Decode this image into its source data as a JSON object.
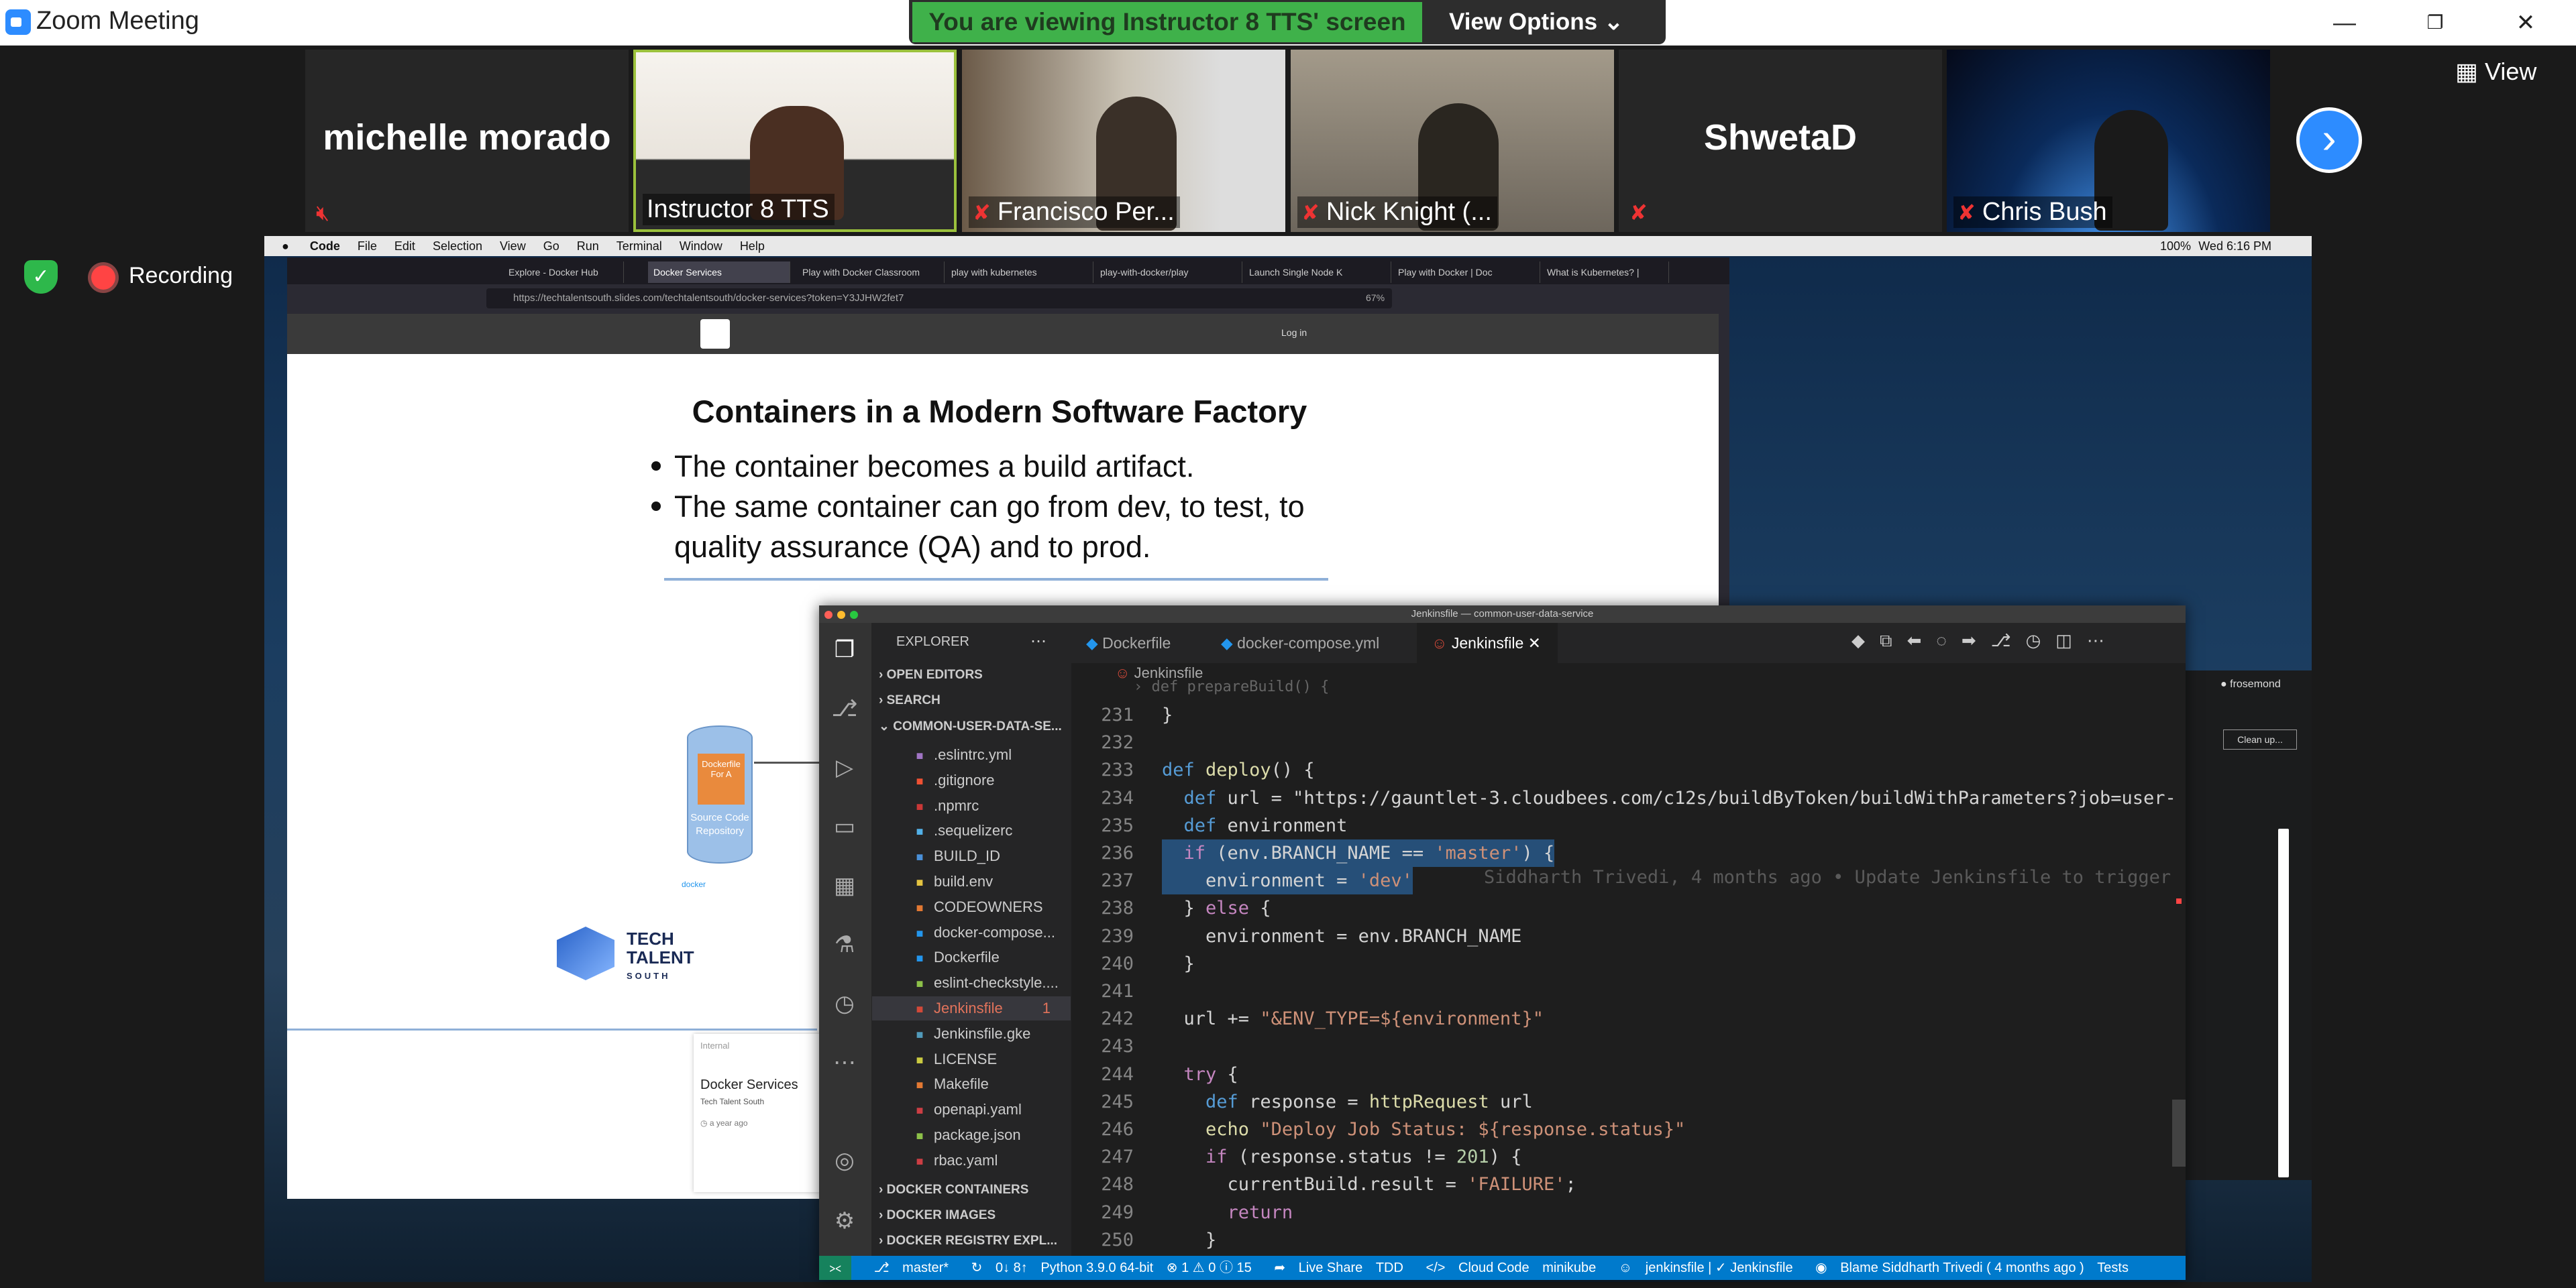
{
  "zoom": {
    "window_title": "Zoom Meeting",
    "viewing_banner": "You are viewing Instructor 8 TTS' screen",
    "view_options": "View Options",
    "view_label": "View",
    "recording": "Recording",
    "participants": [
      {
        "name": "michelle morado",
        "muted": true,
        "video": false
      },
      {
        "name": "Instructor 8 TTS",
        "muted": false,
        "video": true,
        "active": true
      },
      {
        "name": "Francisco Per...",
        "muted": true,
        "video": true
      },
      {
        "name": "Nick Knight (...",
        "muted": true,
        "video": true
      },
      {
        "name": "ShwetaD",
        "muted": true,
        "video": false
      },
      {
        "name": "Chris Bush",
        "muted": true,
        "video": true
      }
    ],
    "colors": {
      "accent": "#2d8cff",
      "banner_green": "#3fb14a",
      "active_border": "#9bc13c"
    }
  },
  "mac": {
    "menu": [
      "Code",
      "File",
      "Edit",
      "Selection",
      "View",
      "Go",
      "Run",
      "Terminal",
      "Window",
      "Help"
    ],
    "battery": "100%",
    "clock": "Wed 6:16 PM"
  },
  "browser": {
    "tabs": [
      "Explore - Docker Hub",
      "Docker Services",
      "Play with Docker Classroom",
      "play with kubernetes",
      "play-with-docker/play",
      "Launch Single Node K",
      "Play with Docker | Doc",
      "What is Kubernetes? |"
    ],
    "url": "https://techtalentsouth.slides.com/techtalentsouth/docker-services?token=Y3JJHW2fet7",
    "zoom": "67%",
    "login": "Log in"
  },
  "slide": {
    "title": "Containers in a Modern Software Factory",
    "bullets": [
      "The container becomes a build artifact.",
      "The same container can go from dev, to test, to",
      "quality assurance (QA) and to prod."
    ],
    "db_label_top": "Dockerfile For A",
    "db_label": "Source Code Repository",
    "docker_small": "docker",
    "logo_line1": "TECH",
    "logo_line2": "TALENT",
    "logo_line3": "SOUTH",
    "card_tag": "Internal",
    "card_title": "Docker Services",
    "card_sub": "Tech Talent South",
    "card_time": "a year ago",
    "user": "frosemond",
    "cleanup": "Clean up..."
  },
  "vscode": {
    "window_title": "Jenkinsfile — common-user-data-service",
    "explorer": "EXPLORER",
    "sections": {
      "open_editors": "OPEN EDITORS",
      "search": "SEARCH",
      "project": "COMMON-USER-DATA-SE...",
      "docker_containers": "DOCKER CONTAINERS",
      "docker_images": "DOCKER IMAGES",
      "docker_registry": "DOCKER REGISTRY EXPL..."
    },
    "files": [
      {
        "name": ".eslintrc.yml",
        "icon": "circle-icon",
        "color": "#a074c4"
      },
      {
        "name": ".gitignore",
        "icon": "git-icon",
        "color": "#f05133"
      },
      {
        "name": ".npmrc",
        "icon": "npm-icon",
        "color": "#cb3837"
      },
      {
        "name": ".sequelizerc",
        "icon": "sequelize-icon",
        "color": "#52b0e7"
      },
      {
        "name": "BUILD_ID",
        "icon": "text-icon",
        "color": "#4a90d9"
      },
      {
        "name": "build.env",
        "icon": "env-icon",
        "color": "#e4c441"
      },
      {
        "name": "CODEOWNERS",
        "icon": "owners-icon",
        "color": "#e37933"
      },
      {
        "name": "docker-compose...",
        "icon": "docker-icon",
        "color": "#2396ed"
      },
      {
        "name": "Dockerfile",
        "icon": "docker-icon",
        "color": "#2396ed"
      },
      {
        "name": "eslint-checkstyle....",
        "icon": "file-icon",
        "color": "#8dc149"
      },
      {
        "name": "Jenkinsfile",
        "icon": "jenkins-icon",
        "color": "#d24939",
        "badge": "1",
        "selected": true
      },
      {
        "name": "Jenkinsfile.gke",
        "icon": "gke-icon",
        "color": "#519aba"
      },
      {
        "name": "LICENSE",
        "icon": "license-icon",
        "color": "#cbcb41"
      },
      {
        "name": "Makefile",
        "icon": "make-icon",
        "color": "#e37933"
      },
      {
        "name": "openapi.yaml",
        "icon": "braces-icon",
        "color": "#cc3e44"
      },
      {
        "name": "package.json",
        "icon": "package-icon",
        "color": "#8dc149"
      },
      {
        "name": "rbac.yaml",
        "icon": "braces-icon",
        "color": "#cc3e44"
      }
    ],
    "tabs": [
      "Dockerfile",
      "docker-compose.yml",
      "Jenkinsfile"
    ],
    "breadcrumb": "Jenkinsfile",
    "code": [
      {
        "n": "231",
        "t": "}"
      },
      {
        "n": "232",
        "t": ""
      },
      {
        "n": "233",
        "t": "def deploy() {"
      },
      {
        "n": "234",
        "t": "  def url = \"https://gauntlet-3.cloudbees.com/c12s/buildByToken/buildWithParameters?job=user-"
      },
      {
        "n": "235",
        "t": "  def environment"
      },
      {
        "n": "236",
        "t": "  if (env.BRANCH_NAME == 'master') {"
      },
      {
        "n": "237",
        "t": "    environment = 'dev'"
      },
      {
        "n": "238",
        "t": "  } else {"
      },
      {
        "n": "239",
        "t": "    environment = env.BRANCH_NAME"
      },
      {
        "n": "240",
        "t": "  }"
      },
      {
        "n": "241",
        "t": ""
      },
      {
        "n": "242",
        "t": "  url += \"&ENV_TYPE=${environment}\""
      },
      {
        "n": "243",
        "t": ""
      },
      {
        "n": "244",
        "t": "  try {"
      },
      {
        "n": "245",
        "t": "    def response = httpRequest url"
      },
      {
        "n": "246",
        "t": "    echo \"Deploy Job Status: ${response.status}\""
      },
      {
        "n": "247",
        "t": "    if (response.status != 201) {"
      },
      {
        "n": "248",
        "t": "      currentBuild.result = 'FAILURE';"
      },
      {
        "n": "249",
        "t": "      return"
      },
      {
        "n": "250",
        "t": "    }"
      }
    ],
    "blame": "Siddharth Trivedi, 4 months ago • Update Jenkinsfile to trigger",
    "status": {
      "branch": "master*",
      "sync": "0↓ 8↑",
      "python": "Python 3.9.0 64-bit",
      "problems": "⊗ 1 ⚠ 0 ⓘ 15",
      "live_share": "Live Share",
      "tdd": "TDD",
      "cloud_code": "Cloud Code",
      "minikube": "minikube",
      "jenkins": "jenkinsfile | ✓ Jenkinsfile",
      "blame": "Blame Siddharth Trivedi ( 4 months ago )",
      "tests": "Tests"
    }
  }
}
